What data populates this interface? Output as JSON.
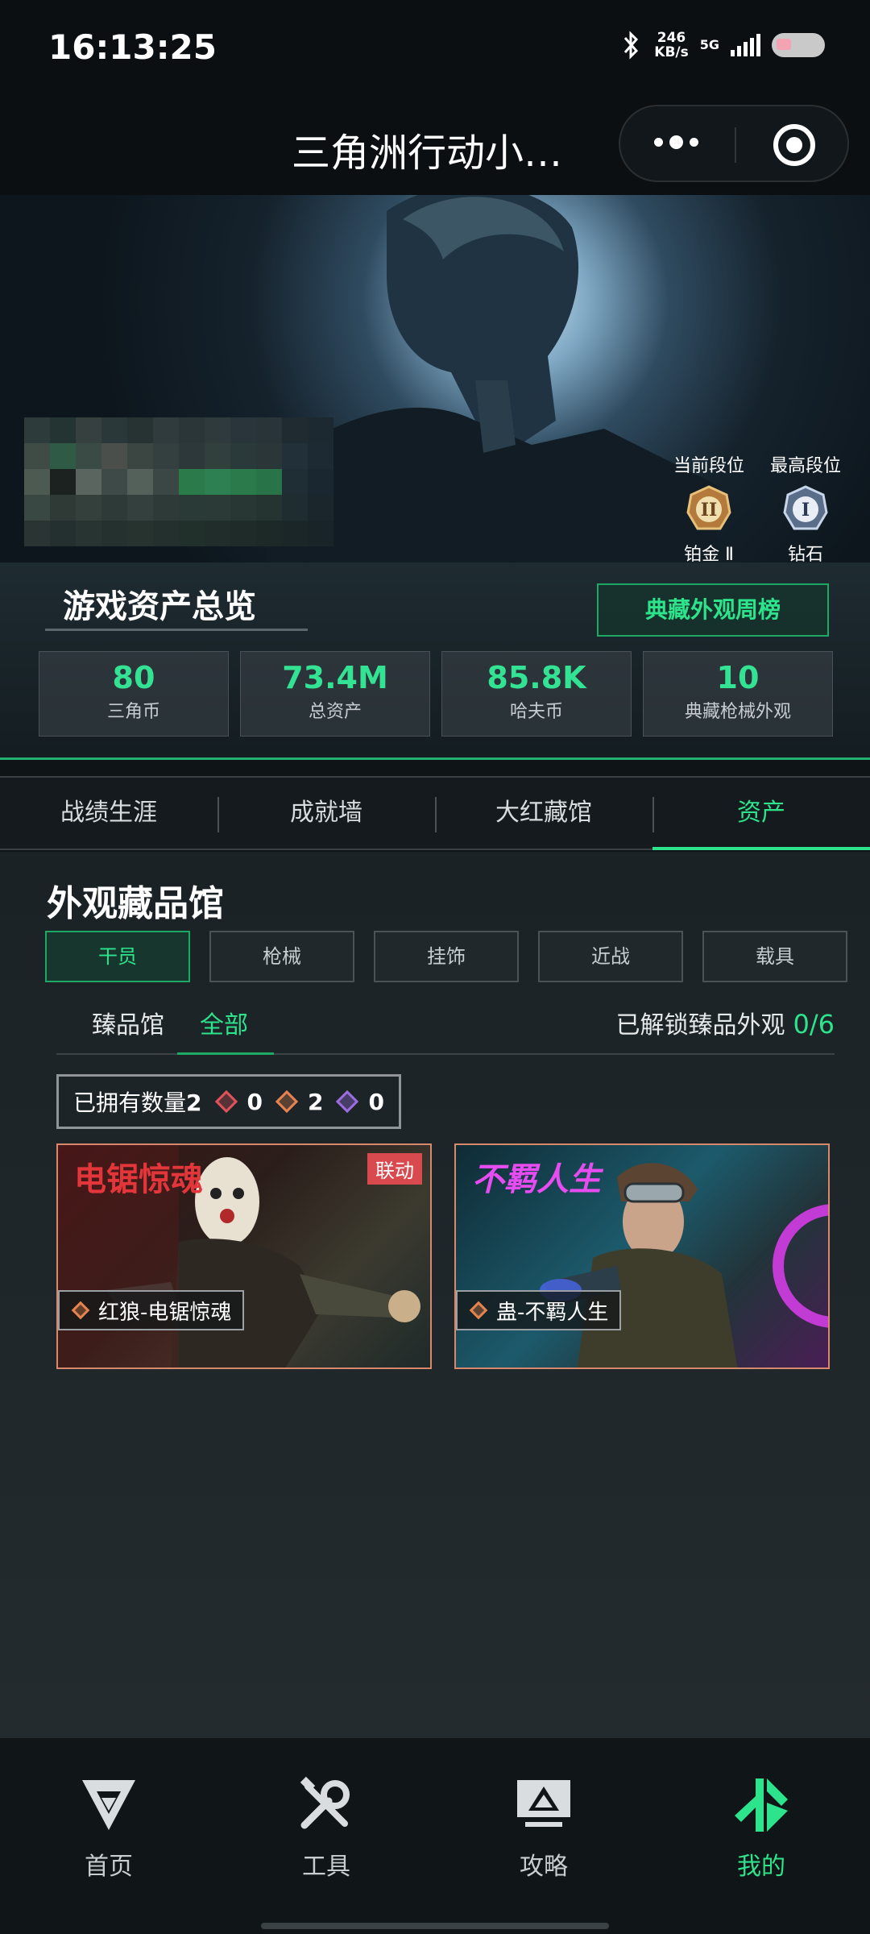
{
  "status_bar": {
    "time": "16:13:25",
    "net_speed_value": "246",
    "net_speed_unit": "KB/s",
    "network_type": "5G"
  },
  "header": {
    "title": "三角洲行动小…"
  },
  "hero": {
    "current_rank_label": "当前段位",
    "highest_rank_label": "最高段位",
    "current_rank_name": "铂金 Ⅱ",
    "highest_rank_name": "钻石",
    "current_rank_numeral": "II",
    "highest_rank_numeral": "I"
  },
  "overview": {
    "title": "游戏资产总览",
    "collection_rank_button": "典藏外观周榜",
    "stats": [
      {
        "value": "80",
        "label": "三角币"
      },
      {
        "value": "73.4M",
        "label": "总资产"
      },
      {
        "value": "85.8K",
        "label": "哈夫币"
      },
      {
        "value": "10",
        "label": "典藏枪械外观"
      }
    ]
  },
  "tabs": [
    {
      "label": "战绩生涯"
    },
    {
      "label": "成就墙"
    },
    {
      "label": "大红藏馆"
    },
    {
      "label": "资产"
    }
  ],
  "appearance": {
    "title": "外观藏品馆",
    "categories": [
      {
        "label": "干员"
      },
      {
        "label": "枪械"
      },
      {
        "label": "挂饰"
      },
      {
        "label": "近战"
      },
      {
        "label": "载具"
      }
    ],
    "subtabs": [
      {
        "label": "臻品馆"
      },
      {
        "label": "全部"
      }
    ],
    "unlock_label": "已解锁臻品外观",
    "unlock_count": "0/6",
    "owned_label": "已拥有数量",
    "owned_total": "2",
    "owned_counts": [
      "0",
      "2",
      "0"
    ],
    "cards": [
      {
        "name": "红狼-电锯惊魂",
        "badge": "联动",
        "logo": "电锯惊魂"
      },
      {
        "name": "蛊-不羁人生",
        "logo": "不羁人生"
      }
    ]
  },
  "bottom_nav": [
    {
      "label": "首页",
      "icon": "home-logo-icon"
    },
    {
      "label": "工具",
      "icon": "tools-icon"
    },
    {
      "label": "攻略",
      "icon": "guide-monitor-icon"
    },
    {
      "label": "我的",
      "icon": "profile-logo-icon"
    }
  ],
  "colors": {
    "accent_green": "#2de38b",
    "background": "#0f1416",
    "badge_red": "#d94a4f"
  }
}
